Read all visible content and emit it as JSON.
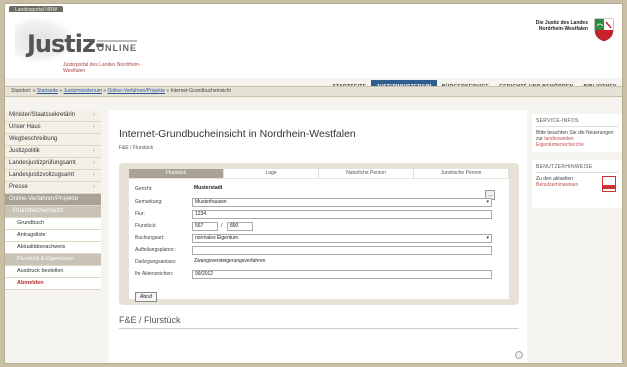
{
  "header": {
    "top_tag": "Landesportal NRW",
    "logo_main": "Justiz-",
    "logo_online": "ONLINE",
    "logo_sub": "Justizportal des Landes Nordrhein-Westfalen",
    "state_name": "Die Justiz des Landes Nordrhein-Westfalen"
  },
  "topnav": [
    "STARTSEITE",
    "JUSTIZMINISTERIUM",
    "BÜRGERSERVICE",
    "GERICHTE UND BEHÖRDEN",
    "BIBLIOTHEK"
  ],
  "breadcrumb": {
    "prefix": "Standort:",
    "links": [
      "Startseite",
      "Justizministerium",
      "Online-Verfahren/Projekte"
    ],
    "current": "Internet-Grundbucheinsicht",
    "sep": "»"
  },
  "sidebar": {
    "items": [
      "Minister/Staatssekretärin",
      "Unser Haus",
      "Wegbeschreibung",
      "Justizpolitik",
      "Landesjustizprüfungsamt",
      "Landesjustizvollzugsamt",
      "Presse"
    ],
    "section": "Online-Verfahren/Projekte",
    "section_sub": "Grundbucheinsicht",
    "subitems": [
      "Grundbuch",
      "Antragsliste",
      "Aktualitätsnachweis"
    ],
    "highlight": "Flurstück & Eigentümer",
    "after": "Ausdruck bestellen",
    "logout": "Abmelden"
  },
  "main": {
    "title": "Internet-Grundbucheinsicht in Nordrhein-Westfalen",
    "sub_crumb": "F&E / Flurstück",
    "tabs": [
      "Flurstück",
      "Lage",
      "Natürliche Person",
      "Juristische Person"
    ],
    "form": {
      "gericht_label": "Gericht:",
      "gericht_value": "Musterstadt",
      "gemarkung_label": "Gemarkung:",
      "gemarkung_value": "Musterhausen",
      "flur_label": "Flur:",
      "flur_value": "1234",
      "flurstueck_label": "Flurstück:",
      "flurstueck_a": "567",
      "flurstueck_sep": "/",
      "flurstueck_b": "890",
      "buchungsart_label": "Buchungsart:",
      "buchungsart_value": "normales Eigentum",
      "aufteilung_label": "Aufteilungsplannr.:",
      "aufteilung_value": "",
      "darlegung_label": "Darlegungsanlass:",
      "darlegung_value": "Zwangsversteigerungsverfahren",
      "aktenzeichen_label": "Ihr Aktenzeichen:",
      "aktenzeichen_value": "99/2012",
      "submit": "Abruf"
    },
    "section_title": "F&E / Flurstück"
  },
  "right": {
    "service_title": "SERVICE-INFOS",
    "service_text": "Bitte beachten Sie die Neuerungen zur",
    "service_link": "landesweiten Eigentümerrecherche",
    "hinweise_title": "BENUTZERHINWEISE",
    "hinweise_text": "Zu den aktuellen",
    "hinweise_link": "Benutzerhinweisen"
  }
}
